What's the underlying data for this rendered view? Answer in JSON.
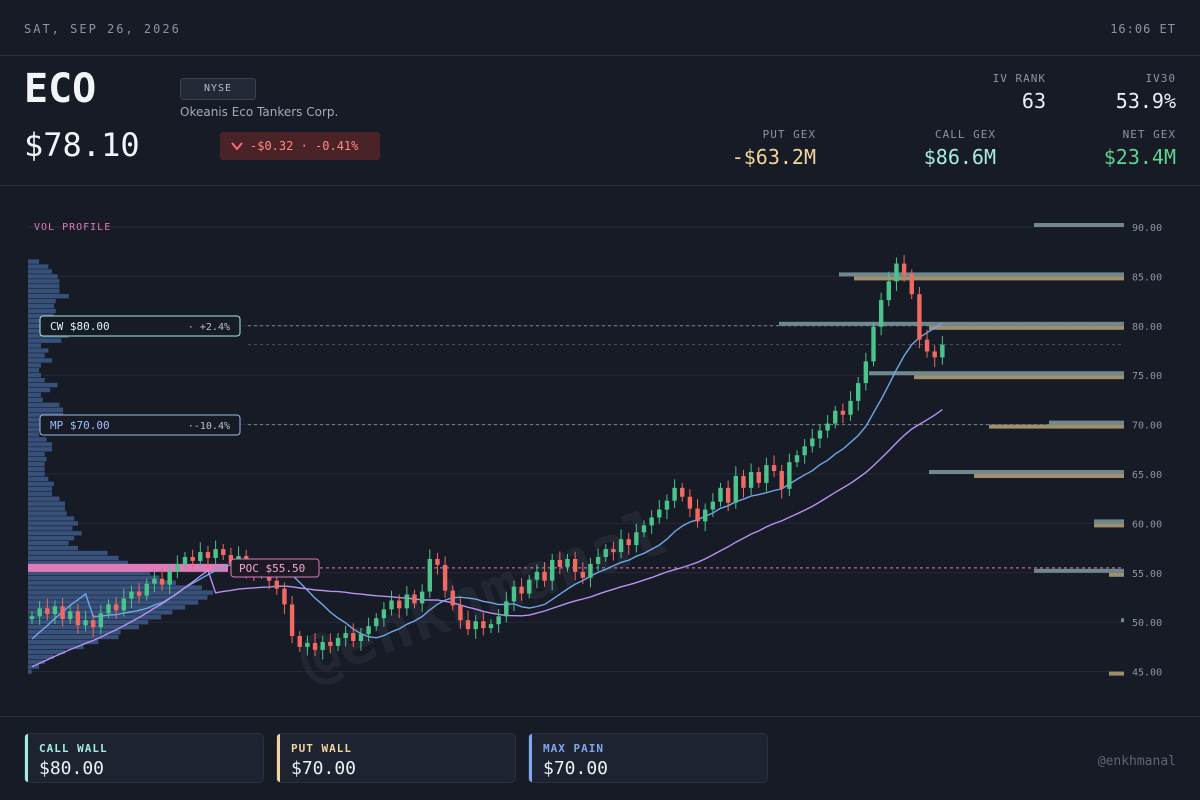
{
  "topbar": {
    "date": "SAT, SEP 26, 2026",
    "time": "16:06 ET"
  },
  "header": {
    "ticker": "ECO",
    "price": "$78.10",
    "exchange": "NYSE",
    "company": "Okeanis Eco Tankers Corp.",
    "change": "-$0.32 · -0.41%",
    "change_direction": "down"
  },
  "stats": {
    "iv_rank": {
      "label": "IV RANK",
      "value": "63"
    },
    "iv30": {
      "label": "IV30",
      "value": "53.9%"
    },
    "put_gex": {
      "label": "PUT GEX",
      "value": "-$63.2M",
      "color": "#f3d49a"
    },
    "call_gex": {
      "label": "CALL GEX",
      "value": "$86.6M",
      "color": "#a8ece0"
    },
    "net_gex": {
      "label": "NET GEX",
      "value": "$23.4M",
      "color": "#5fd38d"
    }
  },
  "chart": {
    "vol_profile_label": "VOL PROFILE",
    "watermark": "@enkhmanal",
    "y_ticks": [
      "90.00",
      "85.00",
      "80.00",
      "75.00",
      "70.00",
      "65.00",
      "60.00",
      "55.00",
      "50.00",
      "45.00"
    ],
    "cw_tag": {
      "label": "CW $80.00",
      "pct": "· +2.4%"
    },
    "mp_tag": {
      "label": "MP $70.00",
      "pct": "·-10.4%"
    },
    "poc_tag": "POC $55.50"
  },
  "chart_data": {
    "type": "candlestick",
    "ylim": [
      44,
      91
    ],
    "levels": {
      "call_wall": 80.0,
      "max_pain": 70.0,
      "poc": 55.5,
      "last": 78.1
    },
    "closes": [
      50.6,
      51.4,
      50.8,
      51.6,
      50.3,
      51.1,
      49.7,
      50.2,
      49.5,
      50.9,
      51.8,
      51.2,
      52.4,
      53.1,
      52.7,
      53.9,
      54.4,
      53.8,
      55.2,
      55.9,
      56.6,
      56.2,
      57.1,
      56.5,
      57.4,
      56.8,
      55.9,
      56.7,
      55.4,
      54.9,
      55.6,
      54.2,
      53.4,
      51.8,
      48.6,
      47.5,
      47.9,
      47.2,
      48.0,
      47.6,
      48.4,
      48.9,
      48.1,
      48.8,
      49.6,
      50.4,
      51.3,
      52.2,
      51.4,
      52.8,
      51.9,
      53.1,
      56.4,
      55.8,
      53.2,
      51.7,
      50.2,
      49.3,
      50.1,
      49.4,
      49.8,
      50.6,
      52.1,
      53.6,
      52.9,
      54.3,
      55.1,
      54.2,
      56.3,
      55.6,
      56.4,
      55.1,
      54.5,
      55.9,
      56.6,
      57.4,
      57.1,
      58.4,
      57.8,
      59.1,
      59.8,
      60.6,
      61.4,
      62.3,
      63.6,
      62.7,
      61.5,
      60.2,
      61.4,
      62.2,
      63.6,
      62.1,
      64.8,
      63.6,
      65.2,
      64.1,
      65.9,
      65.3,
      63.5,
      66.2,
      66.9,
      67.8,
      68.6,
      69.4,
      70.1,
      71.4,
      71.0,
      72.4,
      74.2,
      76.4,
      79.9,
      82.6,
      84.5,
      86.3,
      85.2,
      83.2,
      78.6,
      77.4,
      76.8,
      78.1
    ],
    "volume_profile": {
      "bins_from": 90,
      "bin_step": -0.5,
      "values": [
        0,
        0,
        0,
        0,
        0,
        0,
        0,
        0.06,
        0.11,
        0.13,
        0.16,
        0.17,
        0.17,
        0.17,
        0.22,
        0.15,
        0.14,
        0.15,
        0.14,
        0.11,
        0.09,
        0.14,
        0.22,
        0.18,
        0.07,
        0.11,
        0.09,
        0.13,
        0.07,
        0.06,
        0.07,
        0.09,
        0.16,
        0.12,
        0.07,
        0.08,
        0.17,
        0.19,
        0.19,
        0.19,
        0.19,
        0.13,
        0.06,
        0.1,
        0.13,
        0.13,
        0.09,
        0.1,
        0.09,
        0.09,
        0.09,
        0.11,
        0.14,
        0.13,
        0.13,
        0.17,
        0.2,
        0.2,
        0.21,
        0.25,
        0.27,
        0.24,
        0.29,
        0.25,
        0.22,
        0.27,
        0.43,
        0.49,
        0.54,
        0.61,
        0.66,
        0.71,
        0.8,
        0.94,
        1.0,
        0.97,
        0.92,
        0.85,
        0.78,
        0.72,
        0.65,
        0.6,
        0.5,
        0.49,
        0.38,
        0.3,
        0.2,
        0.14,
        0.09,
        0.06,
        0.02
      ]
    },
    "gex_bars": [
      {
        "strike": 90,
        "call": 0.6,
        "put": 0.0
      },
      {
        "strike": 85,
        "call": 1.9,
        "put": 1.8
      },
      {
        "strike": 80,
        "call": 2.3,
        "put": 1.3
      },
      {
        "strike": 75,
        "call": 1.7,
        "put": 1.4
      },
      {
        "strike": 70,
        "call": 0.5,
        "put": 0.9
      },
      {
        "strike": 65,
        "call": 1.3,
        "put": 1.0
      },
      {
        "strike": 60,
        "call": 0.2,
        "put": 0.2
      },
      {
        "strike": 55,
        "call": 0.6,
        "put": 0.1
      },
      {
        "strike": 50,
        "call": 0.02,
        "put": 0.0
      },
      {
        "strike": 45,
        "call": 0.0,
        "put": 0.1
      }
    ]
  },
  "footer": {
    "cards": [
      {
        "label": "CALL WALL",
        "value": "$80.00",
        "color": "#a8ece0"
      },
      {
        "label": "PUT WALL",
        "value": "$70.00",
        "color": "#f3d49a"
      },
      {
        "label": "MAX PAIN",
        "value": "$70.00",
        "color": "#7fa8f0"
      }
    ],
    "handle": "@enkhmanal"
  }
}
